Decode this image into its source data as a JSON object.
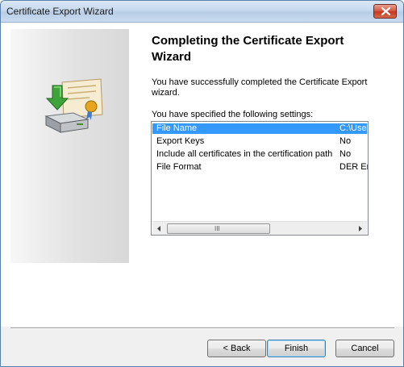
{
  "window": {
    "title": "Certificate Export Wizard"
  },
  "wizard": {
    "heading": "Completing the Certificate Export Wizard",
    "intro": "You have successfully completed the Certificate Export wizard.",
    "settings_label": "You have specified the following settings:"
  },
  "settings": {
    "rows": [
      {
        "name": "File Name",
        "value": "C:\\Use",
        "selected": true
      },
      {
        "name": "Export Keys",
        "value": "No",
        "selected": false
      },
      {
        "name": "Include all certificates in the certification path",
        "value": "No",
        "selected": false
      },
      {
        "name": "File Format",
        "value": "DER En",
        "selected": false
      }
    ],
    "scroll_grip": "III"
  },
  "buttons": {
    "back": "< Back",
    "finish": "Finish",
    "cancel": "Cancel"
  },
  "colors": {
    "selection": "#3399ff",
    "close_button": "#c4381f",
    "titlebar": "#c6d9ee"
  },
  "icons": {
    "close": "close-icon",
    "wizard": "certificate-export-icon",
    "scroll_left": "arrow-left-icon",
    "scroll_right": "arrow-right-icon"
  }
}
